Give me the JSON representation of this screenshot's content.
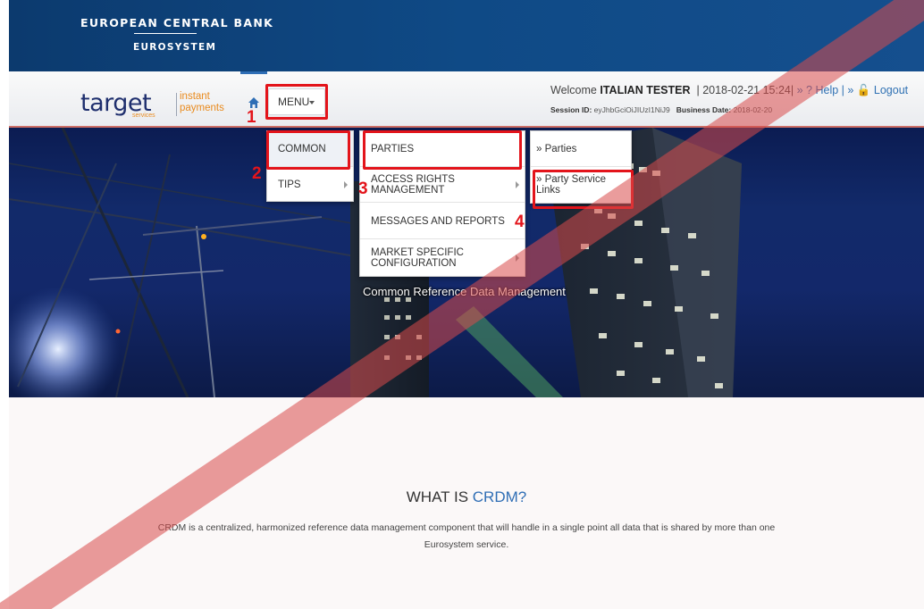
{
  "header": {
    "bank_name": "EUROPEAN CENTRAL BANK",
    "bank_sub": "EUROSYSTEM"
  },
  "logo": {
    "word": "target",
    "services": "services",
    "product_line1": "instant",
    "product_line2": "payments"
  },
  "nav": {
    "home_icon": "home-icon",
    "menu_label": "MENU"
  },
  "user": {
    "welcome_prefix": "Welcome",
    "name": "ITALIAN TESTER",
    "datetime": "| 2018-02-21 15:24|",
    "help_label": "» ? Help",
    "separator": "| »",
    "logout_label": "Logout",
    "session_label": "Session ID:",
    "session_value": "eyJhbGciOiJIUzI1NiJ9",
    "business_label": "Business Date:",
    "business_value": "2018-02-20"
  },
  "menu": {
    "level1": [
      {
        "label": "COMMON"
      },
      {
        "label": "TIPS"
      }
    ],
    "level2": [
      {
        "label": "PARTIES"
      },
      {
        "label": "ACCESS RIGHTS MANAGEMENT"
      },
      {
        "label": "MESSAGES AND REPORTS"
      },
      {
        "label": "MARKET SPECIFIC CONFIGURATION"
      }
    ],
    "level3": [
      {
        "label": "» Parties"
      },
      {
        "label": "» Party Service Links"
      }
    ]
  },
  "annotations": [
    "1",
    "2",
    "3",
    "4"
  ],
  "hero": {
    "title": "Common Reference Data Management"
  },
  "content": {
    "title_prefix": "WHAT IS",
    "title_accent": "CRDM?",
    "description": "CRDM is a centralized, harmonized reference data management component that will handle in a single point all data that is shared by more than one Eurosystem service."
  },
  "colors": {
    "header_blue": "#0f4a86",
    "annotation_red": "#e3141b",
    "link_blue": "#3071b3",
    "logo_orange": "#e98b1f",
    "logo_navy": "#1f2f6e"
  }
}
